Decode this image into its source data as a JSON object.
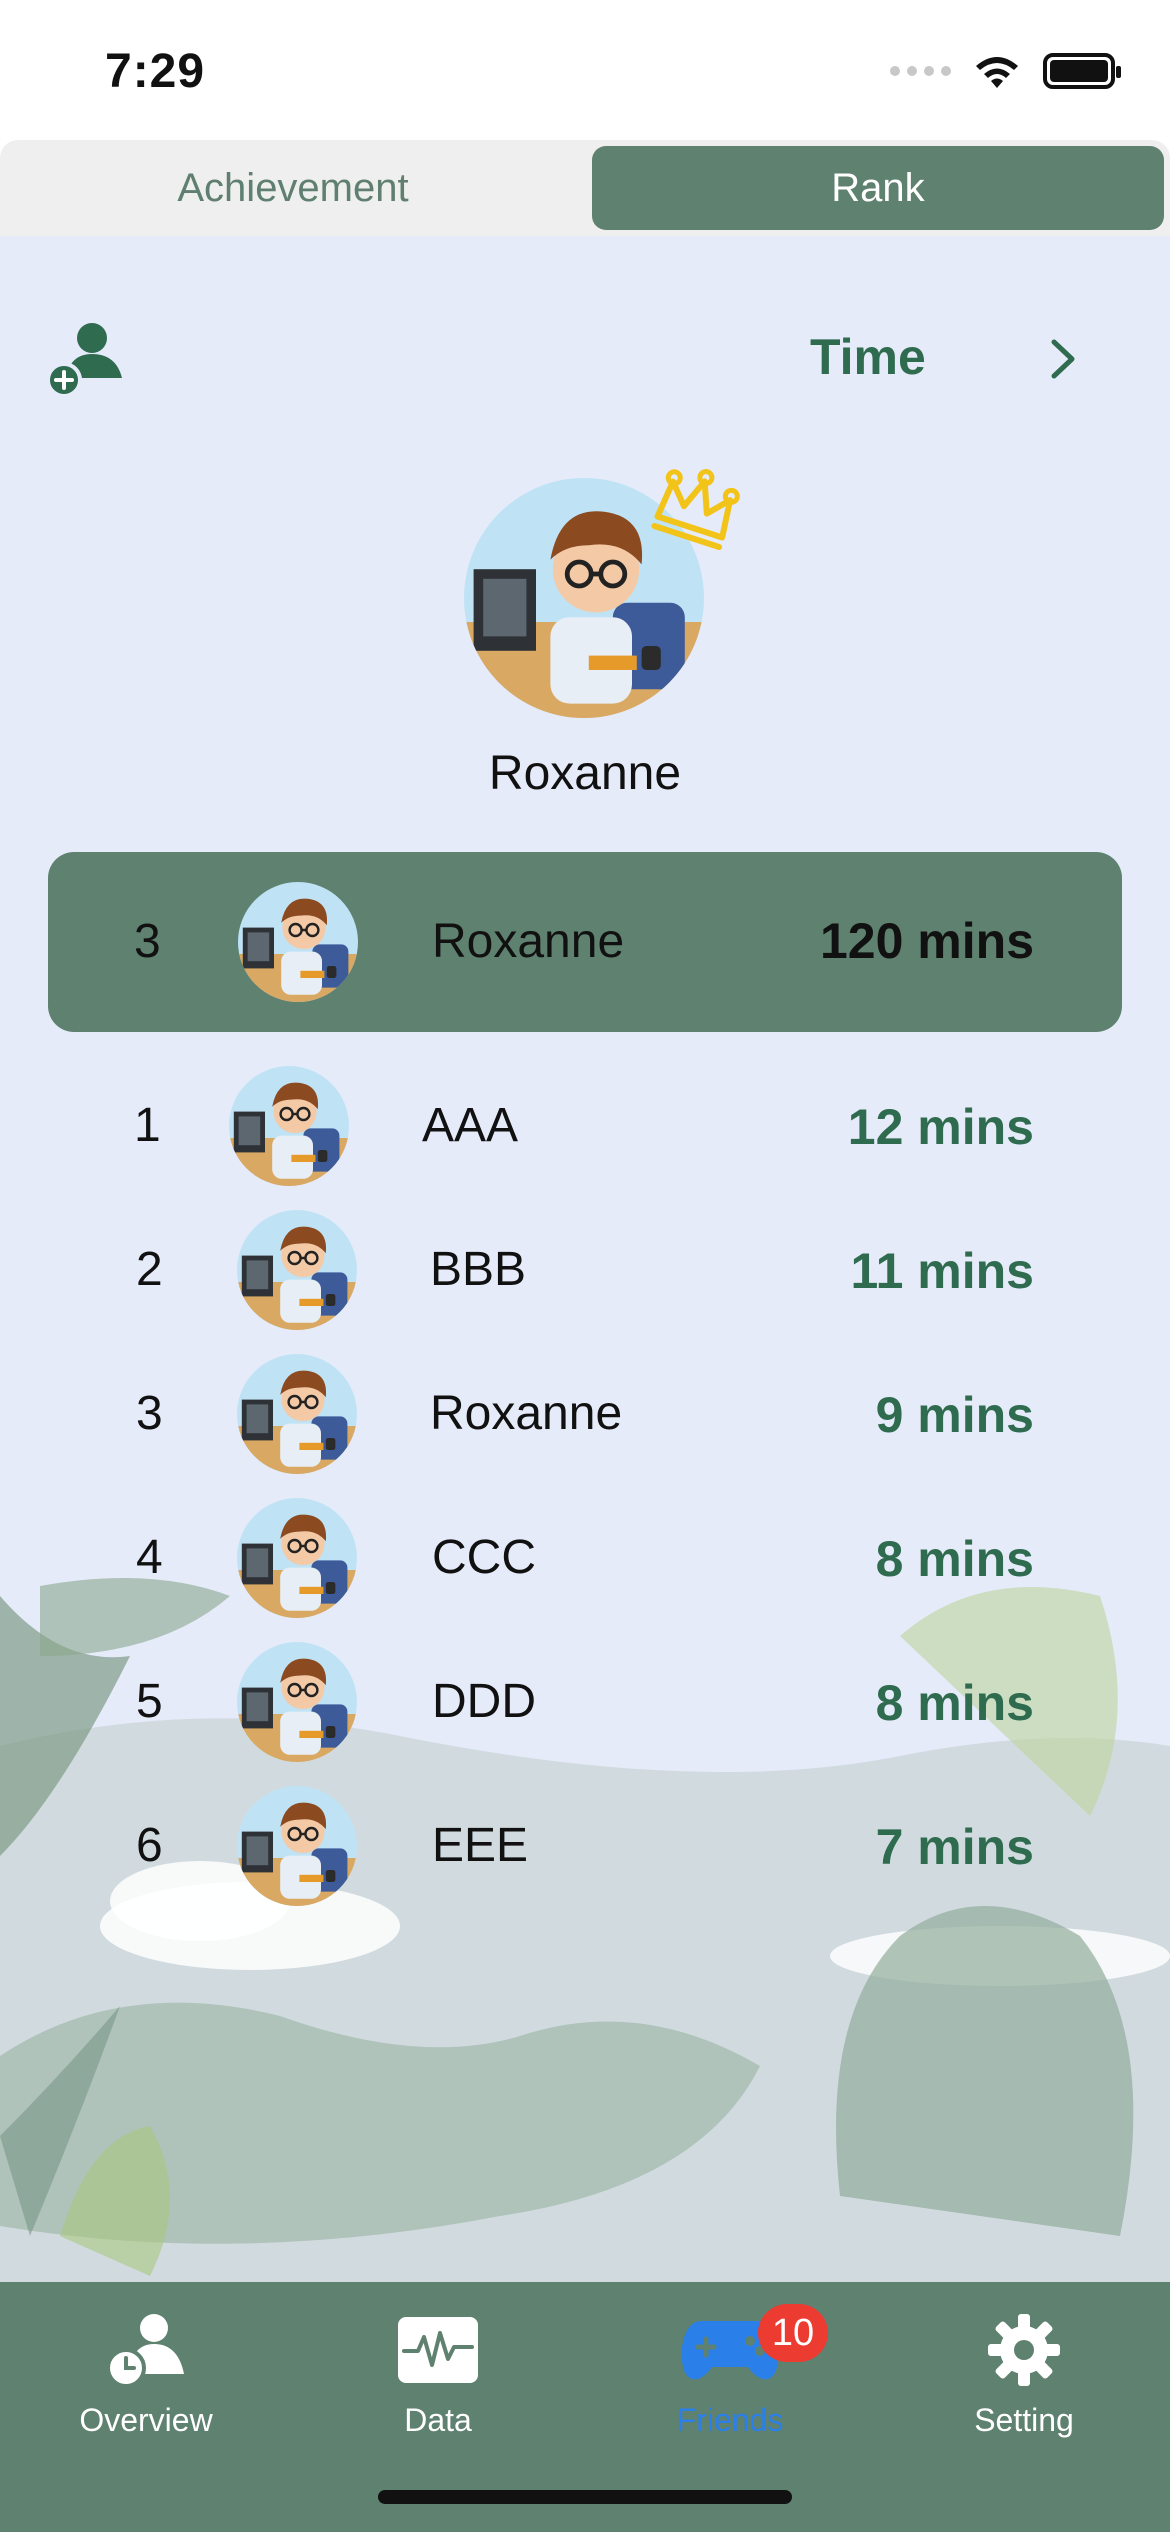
{
  "status_bar": {
    "time": "7:29"
  },
  "segmented_control": {
    "tabs": [
      {
        "label": "Achievement",
        "selected": false
      },
      {
        "label": "Rank",
        "selected": true
      }
    ]
  },
  "header": {
    "add_friend_icon": "add-person-icon",
    "sort_label": "Time",
    "sort_icon": "chevron-right-icon"
  },
  "podium": {
    "name": "Roxanne",
    "badge_icon": "crown-icon"
  },
  "my_rank": {
    "rank": "3",
    "name": "Roxanne",
    "time": "120 mins"
  },
  "leaderboard": [
    {
      "rank": "1",
      "name": "AAA",
      "time": "12 mins"
    },
    {
      "rank": "2",
      "name": "BBB",
      "time": "11 mins"
    },
    {
      "rank": "3",
      "name": "Roxanne",
      "time": "9 mins"
    },
    {
      "rank": "4",
      "name": "CCC",
      "time": "8 mins"
    },
    {
      "rank": "5",
      "name": "DDD",
      "time": "8 mins"
    },
    {
      "rank": "6",
      "name": "EEE",
      "time": "7 mins"
    }
  ],
  "tab_bar": {
    "items": [
      {
        "label": "Overview",
        "icon": "person-clock-icon",
        "active": false
      },
      {
        "label": "Data",
        "icon": "chart-pulse-icon",
        "active": false
      },
      {
        "label": "Friends",
        "icon": "gamepad-icon",
        "active": true,
        "badge": "10"
      },
      {
        "label": "Setting",
        "icon": "gear-icon",
        "active": false
      }
    ]
  },
  "colors": {
    "accent": "#5f8170",
    "accent_text": "#2f6b4f",
    "background": "#e6ebfa",
    "active_tab": "#2a80e8",
    "badge": "#ec3b31",
    "crown": "#f2c318"
  }
}
